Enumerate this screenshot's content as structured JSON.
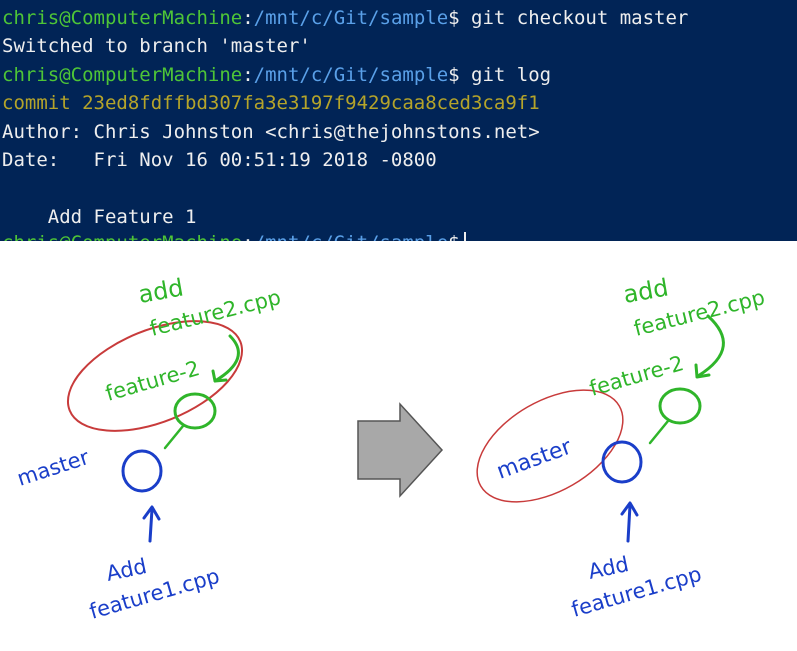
{
  "terminal": {
    "lines": [
      {
        "user": "chris@ComputerMachine",
        "sep": ":",
        "path": "/mnt/c/Git/sample",
        "prompt": "$",
        "cmd": " git checkout master"
      },
      {
        "text": "Switched to branch 'master'"
      },
      {
        "user": "chris@ComputerMachine",
        "sep": ":",
        "path": "/mnt/c/Git/sample",
        "prompt": "$",
        "cmd": " git log"
      },
      {
        "commit": "commit 23ed8fdffbd307fa3e3197f9429caa8ced3ca9f1"
      },
      {
        "text": "Author: Chris Johnston <chris@thejohnstons.net>"
      },
      {
        "text": "Date:   Fri Nov 16 00:51:19 2018 -0800"
      },
      {
        "text": ""
      },
      {
        "text": "    Add Feature 1"
      },
      {
        "user": "chris@ComputerMachine",
        "sep": ":",
        "path": "/mnt/c/Git/sample",
        "prompt": "$",
        "cmd": " "
      }
    ]
  },
  "diagram": {
    "left": {
      "add_line1": "add",
      "add_line2": "feature2.cpp",
      "branch_feature": "feature-2",
      "branch_master": "master",
      "add1_line1": "Add",
      "add1_line2": "feature1.cpp"
    },
    "right": {
      "add_line1": "add",
      "add_line2": "feature2.cpp",
      "branch_feature": "feature-2",
      "branch_master": "master",
      "add1_line1": "Add",
      "add1_line2": "feature1.cpp"
    }
  },
  "colors": {
    "terminal_bg": "#012456",
    "user": "#4ec537",
    "path": "#5aa0e8",
    "commit": "#b5a42a",
    "green_ink": "#2fb52a",
    "blue_ink": "#1a3ec9",
    "red_ink": "#c83b3b",
    "arrow_fill": "#a8a8a8"
  }
}
